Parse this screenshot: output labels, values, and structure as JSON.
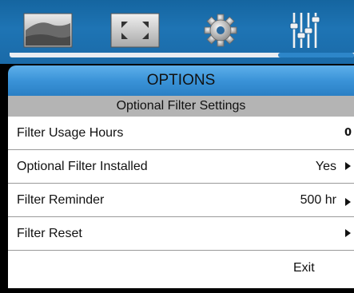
{
  "tabs": [
    {
      "icon": "picture-icon",
      "selected": false
    },
    {
      "icon": "screen-expand-icon",
      "selected": false
    },
    {
      "icon": "settings-gear-icon",
      "selected": false
    },
    {
      "icon": "options-sliders-icon",
      "selected": true
    }
  ],
  "header": {
    "title": "OPTIONS",
    "subtitle": "Optional Filter Settings"
  },
  "menu": {
    "items": [
      {
        "label": "Filter Usage Hours",
        "value": "0",
        "has_arrow": false
      },
      {
        "label": "Optional Filter Installed",
        "value": "Yes",
        "has_arrow": true
      },
      {
        "label": "Filter Reminder",
        "value": "500 hr",
        "has_arrow": true
      },
      {
        "label": "Filter Reset",
        "value": "",
        "has_arrow": true
      }
    ],
    "exit_label": "Exit"
  },
  "colors": {
    "tab_bar": "#1e74b4",
    "header": "#3a93d8",
    "subheader": "#b4b4b4",
    "row_background": "#ffffff"
  }
}
